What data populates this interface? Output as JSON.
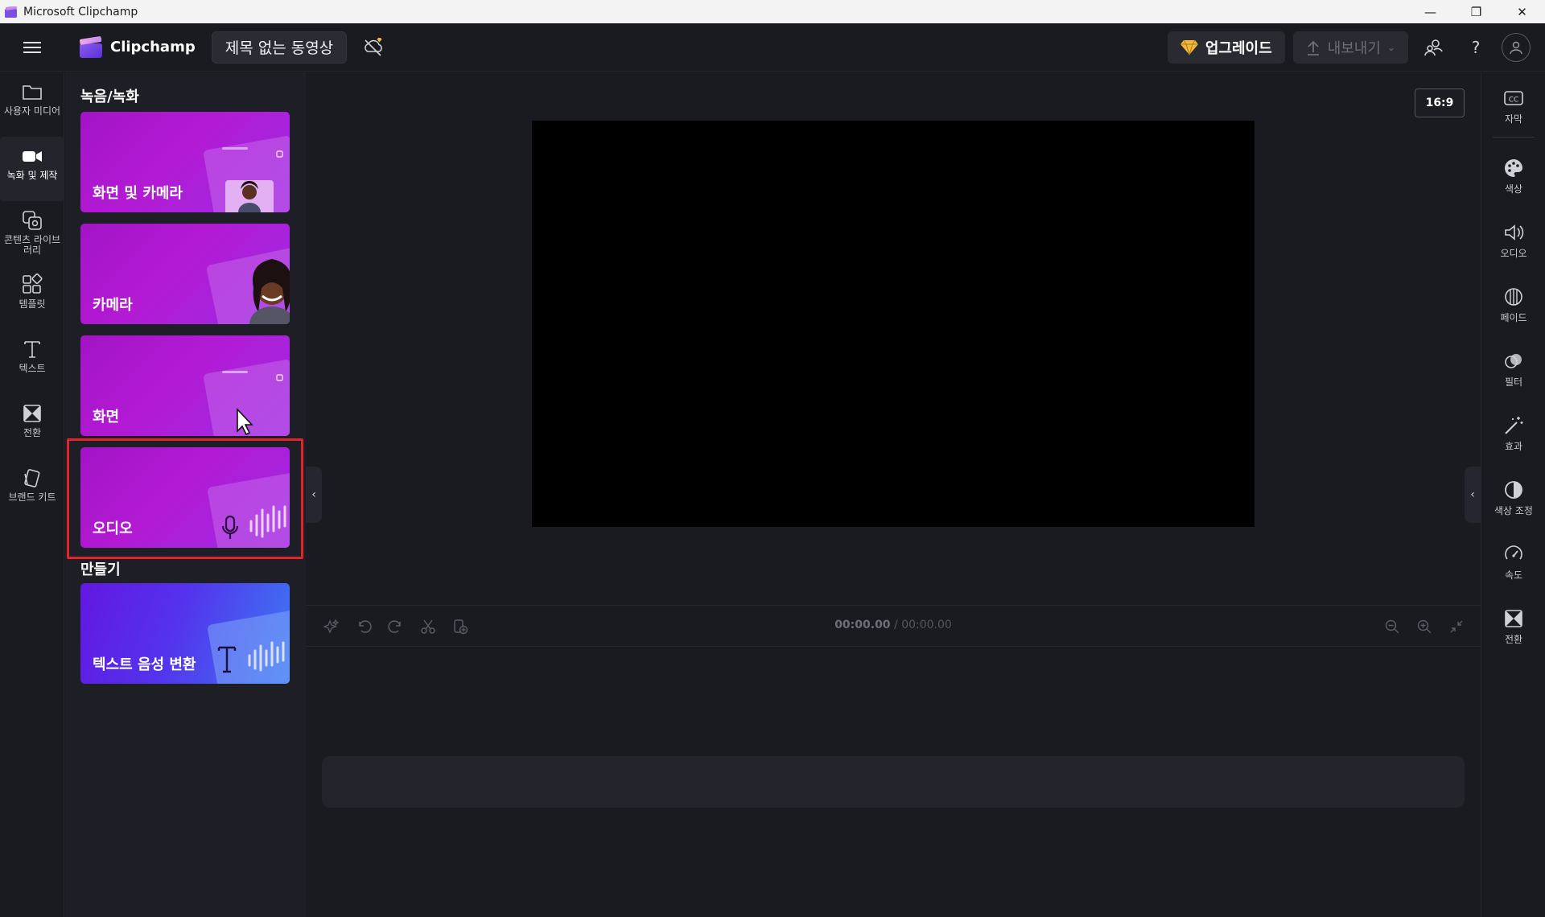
{
  "window": {
    "title": "Microsoft Clipchamp",
    "minimize_label": "—",
    "restore_label": "❐",
    "close_label": "✕"
  },
  "header": {
    "logo_text": "Clipchamp",
    "project_title": "제목 없는 동영상",
    "upgrade_label": "업그레이드",
    "export_label": "내보내기",
    "help_label": "?"
  },
  "left_rail": {
    "items": [
      {
        "label": "사용자 미디어",
        "icon": "folder-icon"
      },
      {
        "label": "녹화 및 제작",
        "icon": "video-camera-icon"
      },
      {
        "label": "콘텐츠 라이브러리",
        "icon": "content-library-icon"
      },
      {
        "label": "템플릿",
        "icon": "templates-icon"
      },
      {
        "label": "텍스트",
        "icon": "text-icon"
      },
      {
        "label": "전환",
        "icon": "transition-icon"
      },
      {
        "label": "브랜드 키트",
        "icon": "brand-kit-icon"
      }
    ],
    "active_index": 1
  },
  "panel": {
    "record_section_title": "녹음/녹화",
    "create_section_title": "만들기",
    "cards": [
      {
        "label": "화면 및 카메라"
      },
      {
        "label": "카메라"
      },
      {
        "label": "화면"
      },
      {
        "label": "오디오"
      },
      {
        "label": "텍스트 음성 변환"
      }
    ],
    "highlighted_card": "오디오"
  },
  "stage": {
    "aspect_ratio": "16:9"
  },
  "timeline": {
    "current_time": "00:00.00",
    "separator": " / ",
    "total_time": "00:00.00"
  },
  "right_rail": {
    "items": [
      {
        "label": "자막",
        "icon": "captions-icon"
      },
      {
        "label": "색상",
        "icon": "palette-icon"
      },
      {
        "label": "오디오",
        "icon": "speaker-icon"
      },
      {
        "label": "페이드",
        "icon": "fade-icon"
      },
      {
        "label": "필터",
        "icon": "filter-icon"
      },
      {
        "label": "효과",
        "icon": "magic-wand-icon"
      },
      {
        "label": "색상 조정",
        "icon": "color-adjust-icon"
      },
      {
        "label": "속도",
        "icon": "speed-icon"
      },
      {
        "label": "전환",
        "icon": "transition-icon"
      }
    ]
  },
  "colors": {
    "accent_purple": "#a314c6",
    "highlight_red": "#e1242a",
    "background": "#1a1a21"
  }
}
